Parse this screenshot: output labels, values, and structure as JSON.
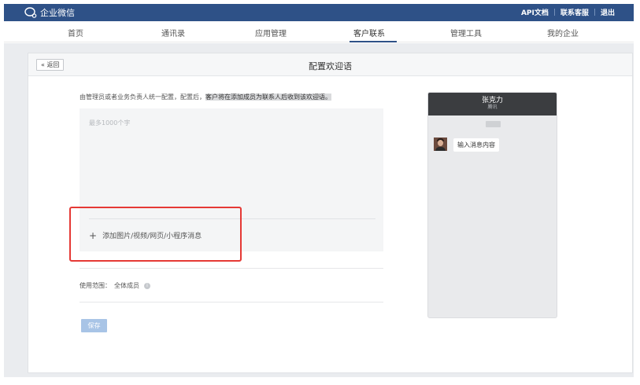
{
  "topbar": {
    "logo_text": "企业微信",
    "links": [
      "API文档",
      "联系客服",
      "退出"
    ],
    "separator": "|"
  },
  "nav": {
    "items": [
      "首页",
      "通讯录",
      "应用管理",
      "客户联系",
      "管理工具",
      "我的企业"
    ],
    "active": "客户联系"
  },
  "page": {
    "back_label": "« 返回",
    "title": "配置欢迎语",
    "desc_plain": "由管理员或者业务负责人统一配置，配置后，",
    "desc_highlight": "客户将在添加成员为联系人后收到该欢迎语。",
    "textarea_placeholder": "最多1000个字",
    "add_plus": "+",
    "add_label": "添加图片/视频/网页/小程序消息",
    "scope_label": "使用范围：",
    "scope_value": "全体成员",
    "info_glyph": "i",
    "save_label": "保存"
  },
  "preview": {
    "name": "张克力",
    "subtitle": "腾讯",
    "time_chip": "",
    "message": "输入消息内容"
  },
  "colors": {
    "brand": "#2e5187",
    "highlight_box": "#e53935",
    "save_button": "#a8c4e6"
  }
}
